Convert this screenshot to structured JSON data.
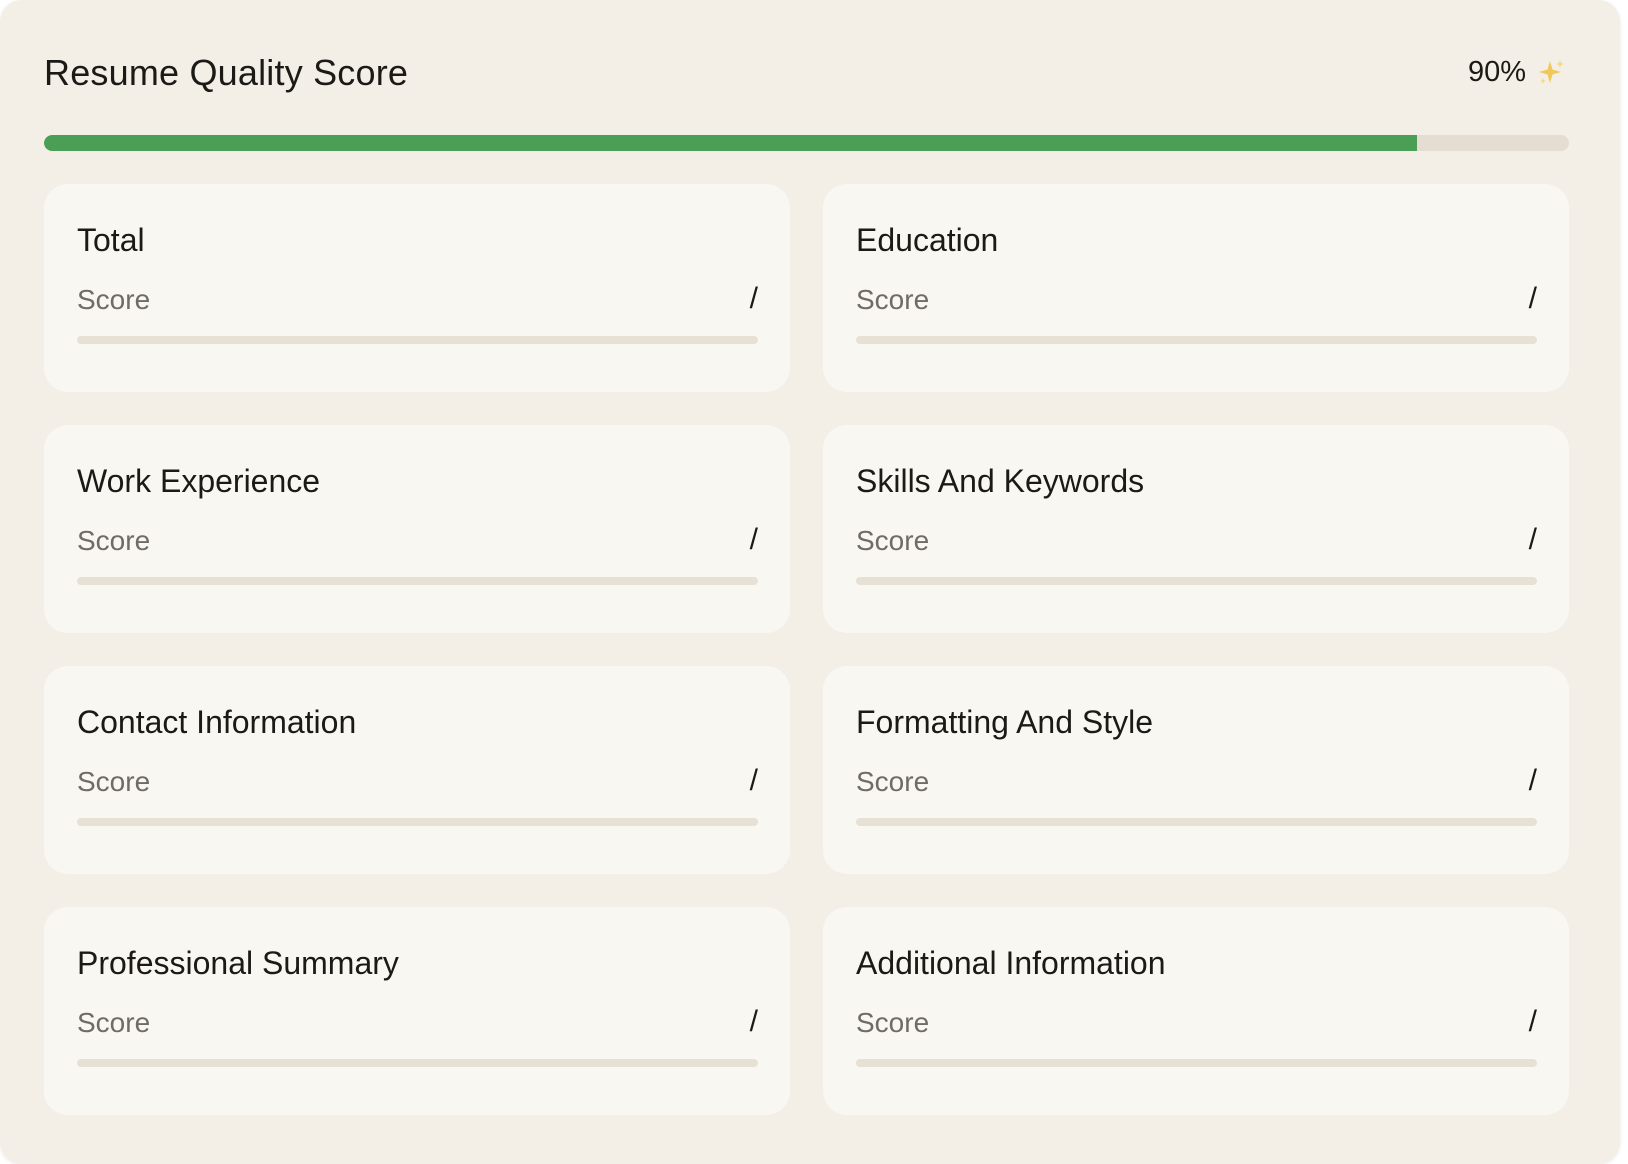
{
  "header": {
    "title": "Resume Quality Score",
    "overall_score_text": "90%",
    "overall_progress_fraction": 0.9
  },
  "colors": {
    "progress_fill": "#4a9e56",
    "progress_track": "#e5ddd1",
    "panel_background": "#f3efe6",
    "card_background": "#f9f7f2",
    "sparkle": "#f2c85a"
  },
  "icons": {
    "header_sparkle": "sparkles-icon"
  },
  "categories": [
    {
      "name": "Total",
      "label": "Score",
      "value": "/"
    },
    {
      "name": "Education",
      "label": "Score",
      "value": "/"
    },
    {
      "name": "Work Experience",
      "label": "Score",
      "value": "/"
    },
    {
      "name": "Skills And Keywords",
      "label": "Score",
      "value": "/"
    },
    {
      "name": "Contact Information",
      "label": "Score",
      "value": "/"
    },
    {
      "name": "Formatting And Style",
      "label": "Score",
      "value": "/"
    },
    {
      "name": "Professional Summary",
      "label": "Score",
      "value": "/"
    },
    {
      "name": "Additional Information",
      "label": "Score",
      "value": "/"
    }
  ]
}
